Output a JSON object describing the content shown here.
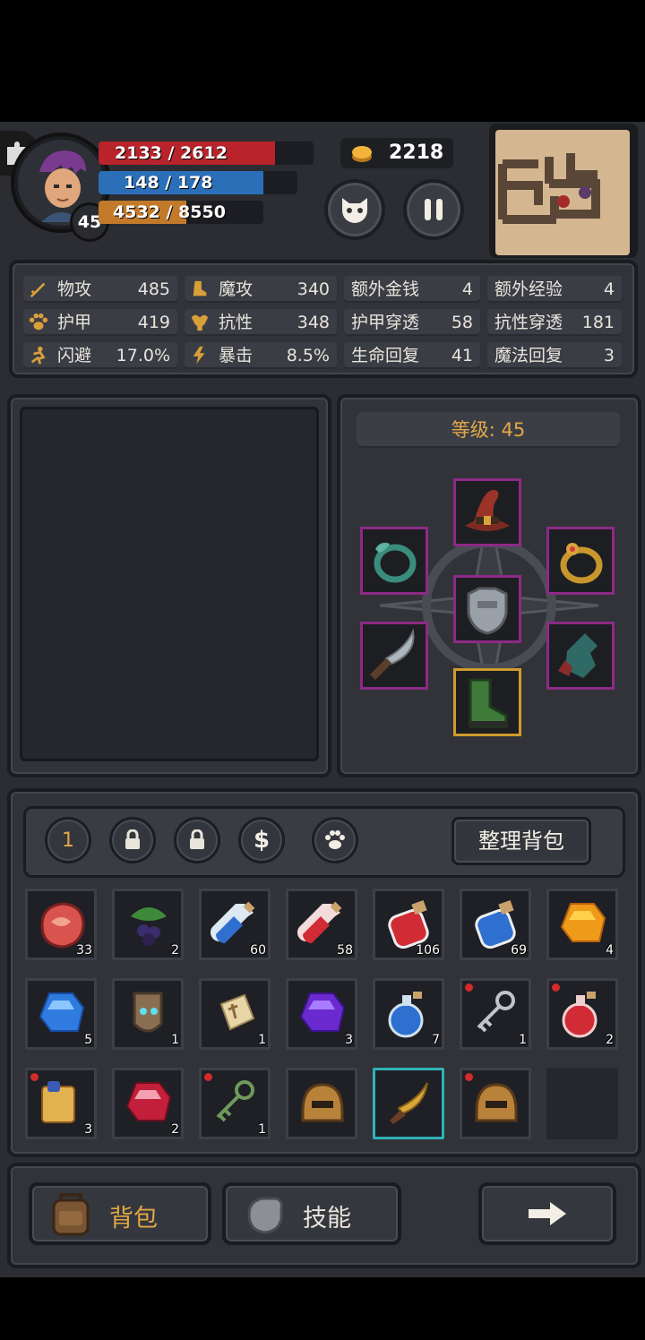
{
  "hud": {
    "level": "45",
    "hp": "2133 / 2612",
    "hp_fraction": 0.82,
    "mp": "148 / 178",
    "mp_fraction": 0.83,
    "exp": "4532 / 8550",
    "exp_fraction": 0.53,
    "gold": "2218",
    "colors": {
      "hp": "#b8232c",
      "mp": "#2a6fb8",
      "exp": "#c27a2a"
    }
  },
  "stats": [
    {
      "label": "物攻",
      "value": "485",
      "icon": "sword-icon"
    },
    {
      "label": "魔攻",
      "value": "340",
      "icon": "magic-boot-icon"
    },
    {
      "label": "额外金钱",
      "value": "4"
    },
    {
      "label": "额外经验",
      "value": "4"
    },
    {
      "label": "护甲",
      "value": "419",
      "icon": "paw-icon"
    },
    {
      "label": "抗性",
      "value": "348",
      "icon": "muscle-icon"
    },
    {
      "label": "护甲穿透",
      "value": "58"
    },
    {
      "label": "抗性穿透",
      "value": "181"
    },
    {
      "label": "闪避",
      "value": "17.0%",
      "icon": "run-icon"
    },
    {
      "label": "暴击",
      "value": "8.5%",
      "icon": "lightning-icon"
    },
    {
      "label": "生命回复",
      "value": "41"
    },
    {
      "label": "魔法回复",
      "value": "3"
    }
  ],
  "equipment": {
    "level_label": "等级: 45"
  },
  "bag_tabs": {
    "tab1": "1",
    "sort_label": "整理背包"
  },
  "inventory": [
    {
      "name": "meat-icon",
      "count": "33"
    },
    {
      "name": "berries-icon",
      "count": "2"
    },
    {
      "name": "blue-potion-icon",
      "count": "60"
    },
    {
      "name": "red-potion-icon",
      "count": "58"
    },
    {
      "name": "red-potion-large-icon",
      "count": "106"
    },
    {
      "name": "blue-potion-large-icon",
      "count": "69"
    },
    {
      "name": "amber-gem-icon",
      "count": "4"
    },
    {
      "name": "blue-gem-icon",
      "count": "5"
    },
    {
      "name": "mask-icon",
      "count": "1"
    },
    {
      "name": "rune-stone-icon",
      "count": "1"
    },
    {
      "name": "purple-gem-icon",
      "count": "3"
    },
    {
      "name": "blue-flask-icon",
      "count": "7"
    },
    {
      "name": "silver-key-icon",
      "count": "1"
    },
    {
      "name": "red-flask-icon",
      "count": "2"
    },
    {
      "name": "scroll-icon",
      "count": "3"
    },
    {
      "name": "ruby-icon",
      "count": "2"
    },
    {
      "name": "green-key-icon",
      "count": "1"
    },
    {
      "name": "helmet-icon",
      "count": ""
    },
    {
      "name": "curved-dagger-icon",
      "count": ""
    },
    {
      "name": "helmet-icon",
      "count": ""
    }
  ],
  "bottom": {
    "bag_label": "背包",
    "skill_label": "技能"
  }
}
